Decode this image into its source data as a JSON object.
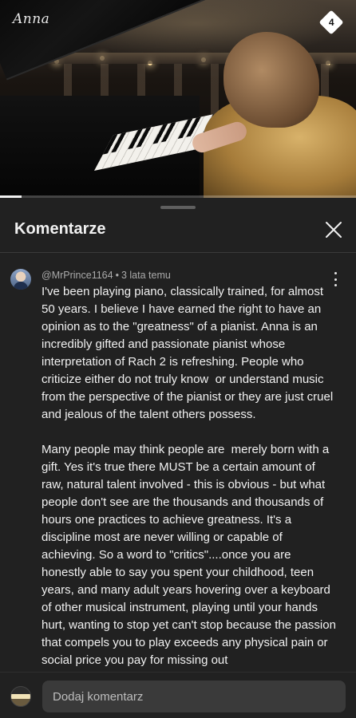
{
  "video": {
    "logo_text": "Anna",
    "badge_icon": "diamond-badge-icon",
    "progress_percent": 6
  },
  "comments_panel": {
    "title": "Komentarze",
    "close_icon": "close-icon"
  },
  "comment": {
    "author": "@MrPrince1164",
    "separator": "•",
    "time": "3 lata temu",
    "paragraphs": [
      "I've been playing piano, classically trained, for almost 50 years. I believe I have earned the right to have an opinion as to the \"greatness\" of a pianist. Anna is an incredibly gifted and passionate pianist whose interpretation of Rach 2 is refreshing. People who criticize either do not truly know  or understand music from the perspective of the pianist or they are just cruel and jealous of the talent others possess.",
      "Many people may think people are  merely born with a gift. Yes it's true there MUST be a certain amount of raw, natural talent involved - this is obvious - but what people don't see are the thousands and thousands of hours one practices to achieve greatness. It's a discipline most are never willing or capable of achieving. So a word to \"critics\"....once you are honestly able to say you spent your childhood, teen years, and many adult years hovering over a keyboard of other musical instrument, playing until your hands hurt, wanting to stop yet can't stop because the passion that compels you to play exceeds any physical pain or social price you pay for missing out"
    ]
  },
  "composer": {
    "placeholder": "Dodaj komentarz"
  }
}
